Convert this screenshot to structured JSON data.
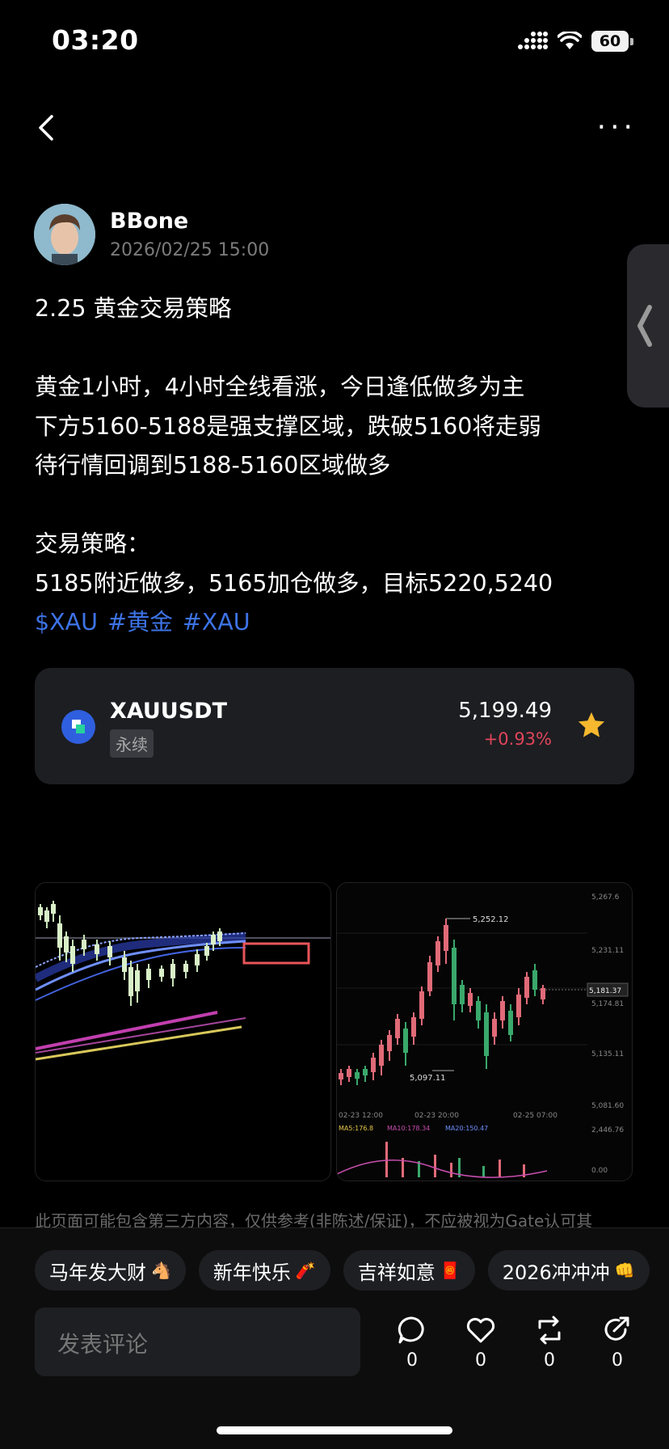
{
  "status_bar": {
    "time": "03:20",
    "battery": "60"
  },
  "post": {
    "author": "BBone",
    "time": "2026/02/25 15:00",
    "title": "2.25 黄金交易策略",
    "lines": [
      "黄金1小时，4小时全线看涨，今日逢低做多为主",
      "下方5160-5188是强支撑区域，跌破5160将走弱",
      "待行情回调到5188-5160区域做多",
      "交易策略：",
      "5185附近做多，5165加仓做多，目标5220,5240"
    ],
    "tags": [
      "$XAU",
      "#黄金",
      "#XAU"
    ]
  },
  "ticker": {
    "symbol": "XAUUSDT",
    "type": "永续",
    "price": "5,199.49",
    "change": "+0.93%",
    "colors": {
      "down": "#e0455a",
      "accent": "#f5b82e"
    }
  },
  "chart2_labels": {
    "high": "5,252.12",
    "low": "5,097.11",
    "current": "5,181.37",
    "axis": [
      "5,267.6",
      "5,231.11",
      "5,174.81",
      "5,135.11",
      "5,081.60",
      "2,446.76",
      "0.00"
    ],
    "dates": [
      "02-23 12:00",
      "02-23 20:00",
      "02-25 07:00"
    ],
    "ma": [
      "MA5:176.8",
      "MA10:178.34",
      "MA20:150.47"
    ]
  },
  "disclaimer": "此页面可能包含第三方内容，仅供参考(非陈述/保证)，不应被视为Gate认可其",
  "chips": [
    {
      "label": "马年发大财",
      "emoji": "🐴"
    },
    {
      "label": "新年快乐",
      "emoji": "🧨"
    },
    {
      "label": "吉祥如意",
      "emoji": "🧧"
    },
    {
      "label": "2026冲冲冲",
      "emoji": "👊"
    }
  ],
  "comment_placeholder": "发表评论",
  "actions": {
    "comment": "0",
    "like": "0",
    "repost": "0",
    "share": "0"
  }
}
